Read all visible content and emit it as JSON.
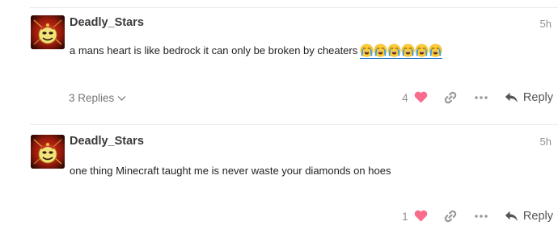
{
  "posts": [
    {
      "username": "Deadly_Stars",
      "age": "5h",
      "text": "a mans heart is like bedrock it can only be broken by cheaters",
      "emoji": [
        "sob",
        "sob",
        "sob",
        "sob",
        "sob",
        "sob"
      ],
      "replies_label": "3 Replies",
      "like_count": "4",
      "reply_label": "Reply"
    },
    {
      "username": "Deadly_Stars",
      "age": "5h",
      "text": "one thing Minecraft taught me is never waste your diamonds on hoes",
      "like_count": "1",
      "reply_label": "Reply"
    }
  ],
  "icons": {
    "like": "heart-icon",
    "copy_link": "link-icon",
    "more": "ellipsis-icon",
    "reply": "reply-arrow-icon",
    "replies_toggle": "chevron-down-icon",
    "emoji": "loudly-crying-face-emoji"
  },
  "colors": {
    "heart": "#fa6c8d",
    "muted": "#919191",
    "link_underline": "#2e79c7"
  }
}
